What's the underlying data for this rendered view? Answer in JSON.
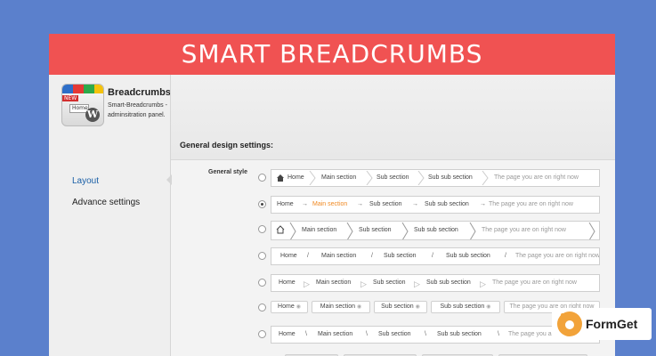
{
  "banner": {
    "title": "SMART BREADCRUMBS"
  },
  "plugin": {
    "title": "Breadcrumbs",
    "description": "Smart-Breadcrumbs - adminsitration panel.",
    "logo_badge": "NEW",
    "logo_mini_text": "Home"
  },
  "sidebar": {
    "items": [
      {
        "label": "Layout",
        "active": true
      },
      {
        "label": "Advance settings",
        "active": false
      }
    ]
  },
  "main": {
    "section_title": "General design settings:",
    "style_label": "General style"
  },
  "crumbs": {
    "home": "Home",
    "main": "Main section",
    "sub": "Sub section",
    "subsub": "Sub sub section",
    "current": "The page you are on right now"
  },
  "styles": {
    "selected_index": 1,
    "count": 8
  },
  "colors": {
    "background": "#5b80cc",
    "banner": "#f05252",
    "active_crumb": "#f08a24",
    "nav_active": "#1a5fa6"
  },
  "icons": [
    "home-icon",
    "wordpress-icon",
    "formget-logo-icon"
  ],
  "brand": {
    "label": "FormGet"
  }
}
